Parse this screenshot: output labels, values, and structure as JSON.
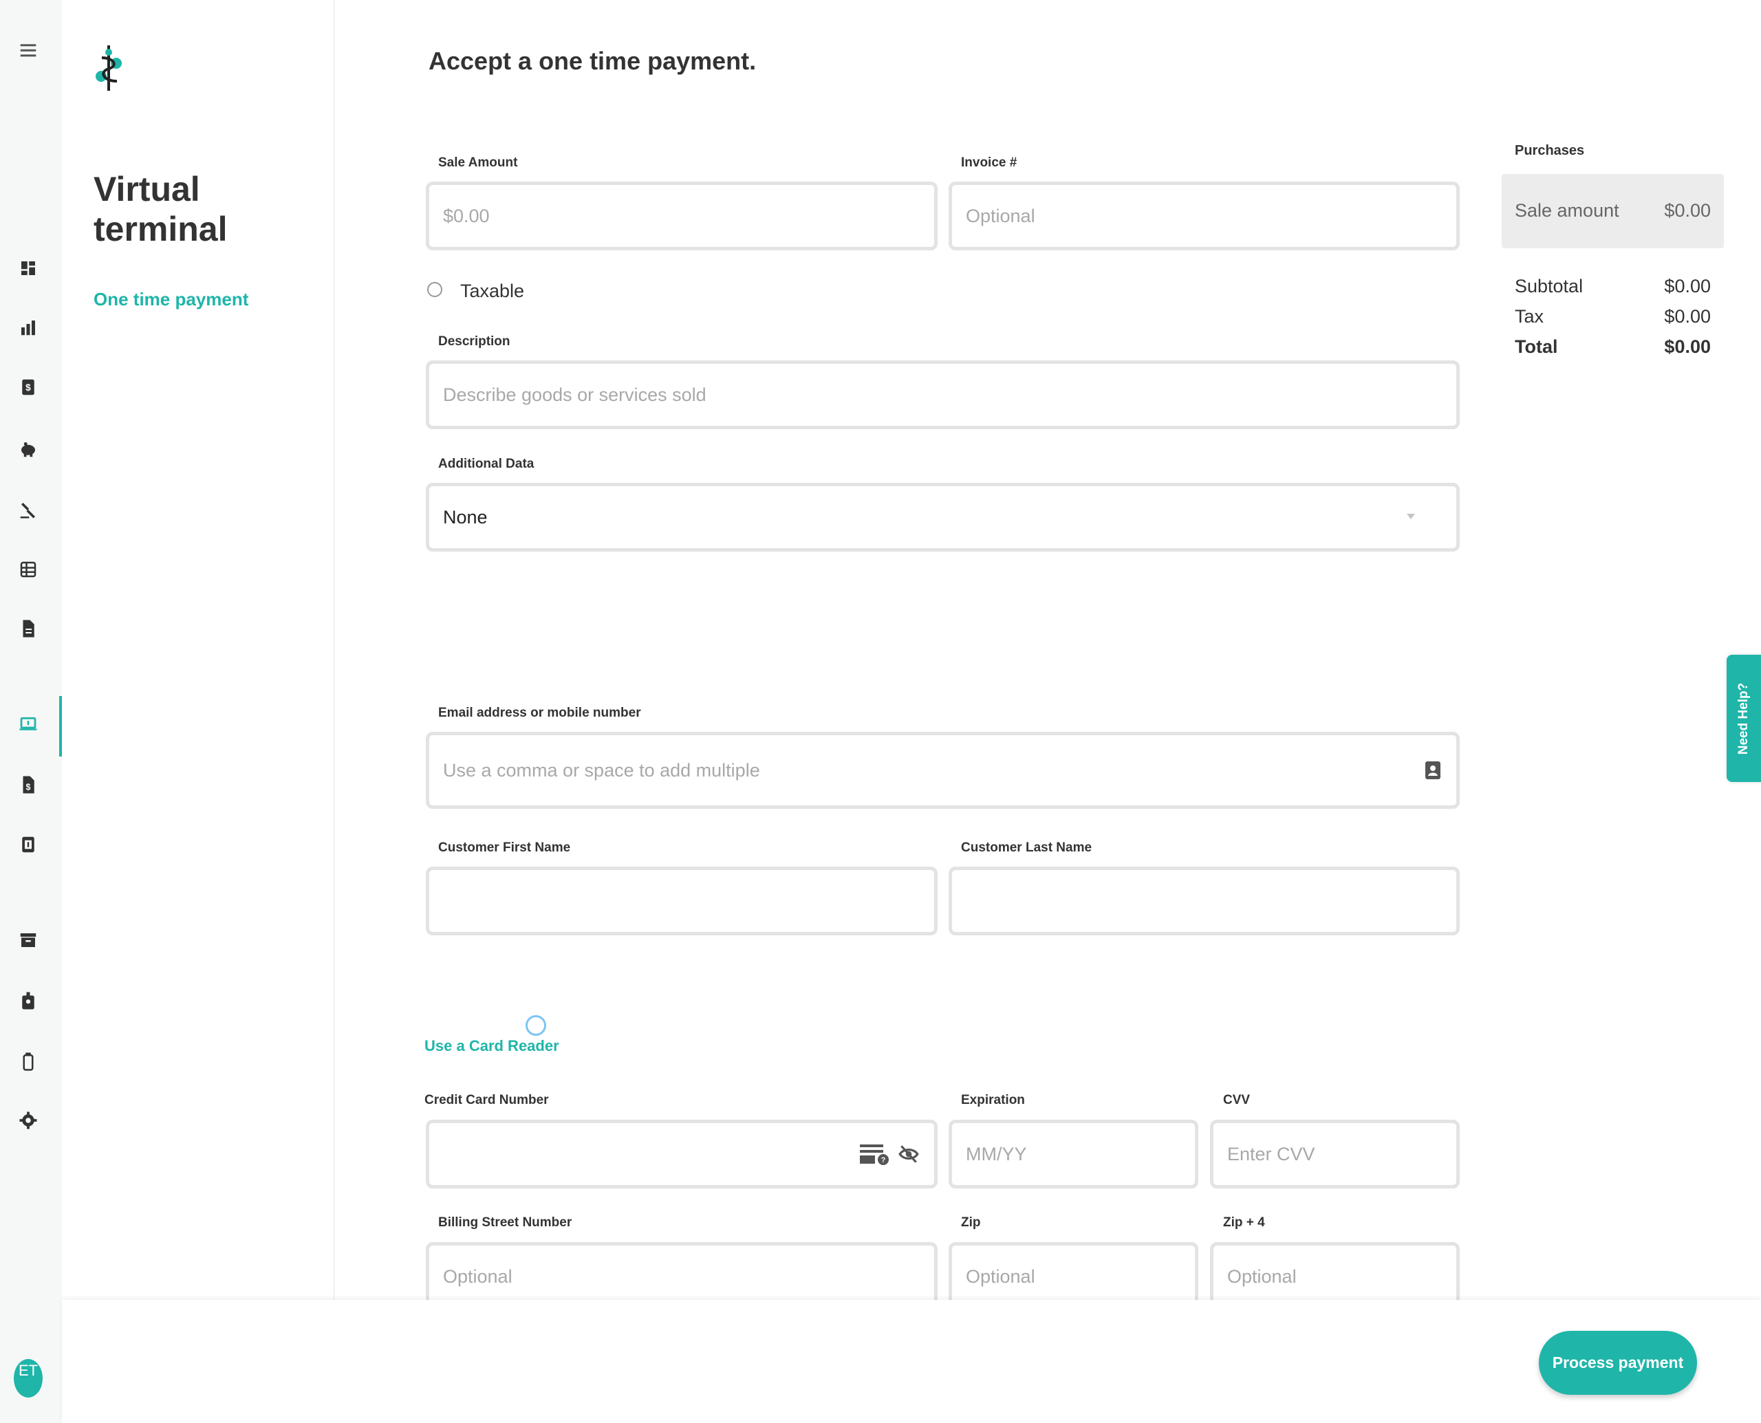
{
  "nav": {
    "menu_icon": "hamburger-menu-icon",
    "items": [
      {
        "icon": "dashboard-icon"
      },
      {
        "icon": "reports-icon"
      },
      {
        "icon": "transactions-icon"
      },
      {
        "icon": "piggy-bank-icon"
      },
      {
        "icon": "disputes-gavel-icon"
      },
      {
        "icon": "table-icon"
      },
      {
        "icon": "document-icon"
      },
      {
        "icon": "virtual-terminal-icon",
        "active": true
      },
      {
        "icon": "invoice-icon"
      },
      {
        "icon": "receipt-icon"
      },
      {
        "icon": "archive-icon"
      },
      {
        "icon": "badge-icon"
      },
      {
        "icon": "device-icon"
      },
      {
        "icon": "settings-icon"
      }
    ],
    "avatar_initials": "ET"
  },
  "subnav": {
    "title": "Virtual terminal",
    "link": "One time payment"
  },
  "form": {
    "heading": "Accept a one time payment.",
    "sale_amount": {
      "label": "Sale Amount",
      "placeholder": "$0.00"
    },
    "invoice": {
      "label": "Invoice #",
      "placeholder": "Optional"
    },
    "taxable_label": "Taxable",
    "description": {
      "label": "Description",
      "placeholder": "Describe goods or services sold"
    },
    "additional_data": {
      "label": "Additional Data",
      "value": "None"
    },
    "email": {
      "label": "Email address or mobile number",
      "placeholder": "Use a comma or space to add multiple"
    },
    "first_name": {
      "label": "Customer First Name",
      "placeholder": ""
    },
    "last_name": {
      "label": "Customer Last Name",
      "placeholder": ""
    },
    "card_reader_link": "Use a Card Reader",
    "card_number": {
      "label": "Credit Card Number",
      "placeholder": ""
    },
    "expiration": {
      "label": "Expiration",
      "placeholder": "MM/YY"
    },
    "cvv": {
      "label": "CVV",
      "placeholder": "Enter CVV"
    },
    "billing_street": {
      "label": "Billing Street Number",
      "placeholder": "Optional"
    },
    "zip": {
      "label": "Zip",
      "placeholder": "Optional"
    },
    "zip4": {
      "label": "Zip + 4",
      "placeholder": "Optional"
    }
  },
  "summary": {
    "title": "Purchases",
    "sale_amount_label": "Sale amount",
    "sale_amount_value": "$0.00",
    "subtotal_label": "Subtotal",
    "subtotal_value": "$0.00",
    "tax_label": "Tax",
    "tax_value": "$0.00",
    "total_label": "Total",
    "total_value": "$0.00"
  },
  "help_tab": "Need Help?",
  "footer": {
    "process_button": "Process payment"
  },
  "colors": {
    "accent": "#1fb5a9",
    "border": "#e3e3e3"
  }
}
